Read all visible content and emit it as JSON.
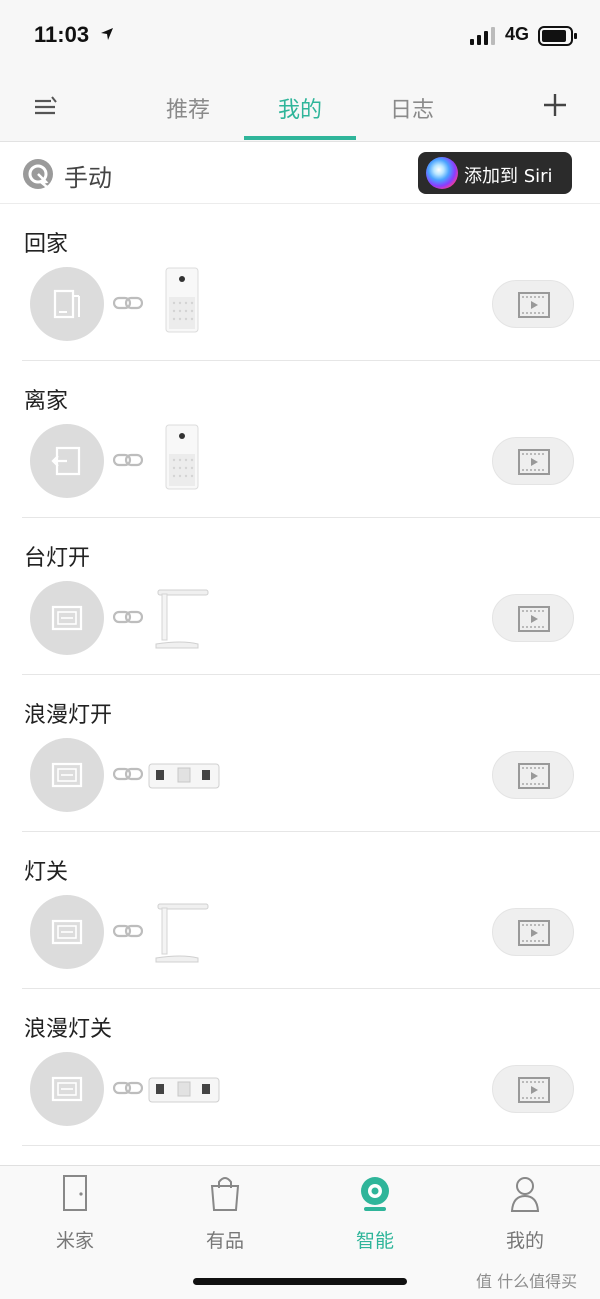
{
  "status_bar": {
    "time": "11:03",
    "network": "4G"
  },
  "top_nav": {
    "tabs": [
      {
        "label": "推荐"
      },
      {
        "label": "我的",
        "active": true
      },
      {
        "label": "日志"
      }
    ]
  },
  "section": {
    "label": "手动",
    "siri_button": "添加到 Siri"
  },
  "scenes": [
    {
      "name": "回家",
      "condition_icon": "door-enter-icon",
      "device": "air-purifier"
    },
    {
      "name": "离家",
      "condition_icon": "door-exit-icon",
      "device": "air-purifier"
    },
    {
      "name": "台灯开",
      "condition_icon": "manual-run-icon",
      "device": "desk-lamp"
    },
    {
      "name": "浪漫灯开",
      "condition_icon": "manual-run-icon",
      "device": "power-strip"
    },
    {
      "name": "灯关",
      "condition_icon": "manual-run-icon",
      "device": "desk-lamp"
    },
    {
      "name": "浪漫灯关",
      "condition_icon": "manual-run-icon",
      "device": "power-strip"
    }
  ],
  "bottom_tabs": [
    {
      "label": "米家",
      "icon": "door-icon"
    },
    {
      "label": "有品",
      "icon": "shopping-bag-icon"
    },
    {
      "label": "智能",
      "icon": "smart-camera-icon",
      "active": true
    },
    {
      "label": "我的",
      "icon": "profile-icon"
    }
  ],
  "watermark": "值 什么值得买",
  "colors": {
    "accent": "#2fb59a",
    "background": "#ffffff",
    "nav_background": "#f7f7f7"
  }
}
